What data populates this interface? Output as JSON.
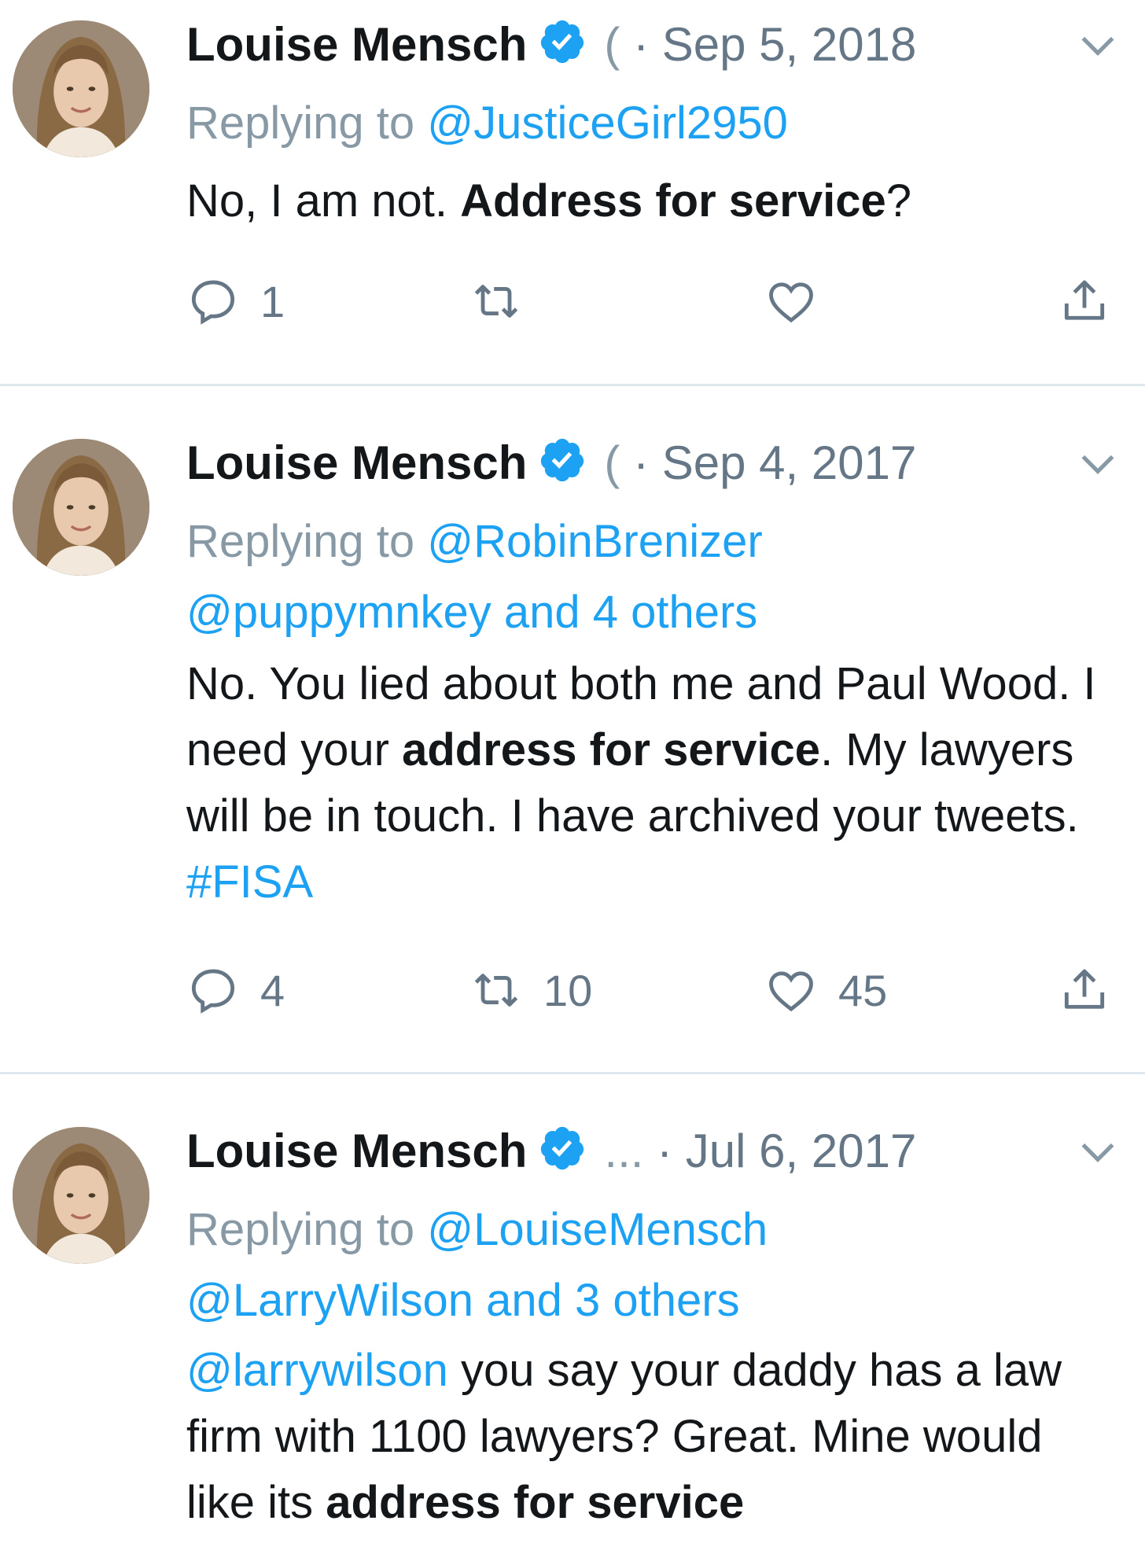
{
  "tweets": [
    {
      "name": "Louise Mensch",
      "handle": "(",
      "dot": "·",
      "date": "Sep 5, 2018",
      "replying_label": "Replying to",
      "replying_to": "@JusticeGirl2950",
      "replying_more": "",
      "text_plain_1": "No, I am not. ",
      "text_bold_1": "Address for service",
      "text_plain_2": "?",
      "replies": "1",
      "retweets": "",
      "likes": ""
    },
    {
      "name": "Louise Mensch",
      "handle": "(",
      "dot": "·",
      "date": "Sep 4, 2017",
      "replying_label": "Replying to",
      "replying_to": "@RobinBrenizer",
      "replying_more": "@puppymnkey and 4 others",
      "text_plain_1": "No. You lied about both me and Paul Wood. I need your ",
      "text_bold_1": "address for service",
      "text_plain_2": ". My lawyers will be in touch. I have archived your tweets. ",
      "hashtag": "#FISA",
      "replies": "4",
      "retweets": "10",
      "likes": "45"
    },
    {
      "name": "Louise Mensch",
      "handle": "...",
      "dot": "·",
      "date": "Jul 6, 2017",
      "replying_label": "Replying to",
      "replying_to": "@LouiseMensch",
      "replying_more": "@LarryWilson and 3 others",
      "mention": "@larrywilson",
      "text_plain_1": " you say your daddy has a law firm with 1100 lawyers? Great. Mine would like its ",
      "text_bold_1": "address for service"
    }
  ],
  "colors": {
    "link": "#1da1f2",
    "muted": "#8899a6",
    "text": "#14171a",
    "divider": "#e1e8ed"
  },
  "icons": [
    "verified-badge-icon",
    "chevron-down-icon",
    "reply-icon",
    "retweet-icon",
    "like-icon",
    "share-icon"
  ]
}
